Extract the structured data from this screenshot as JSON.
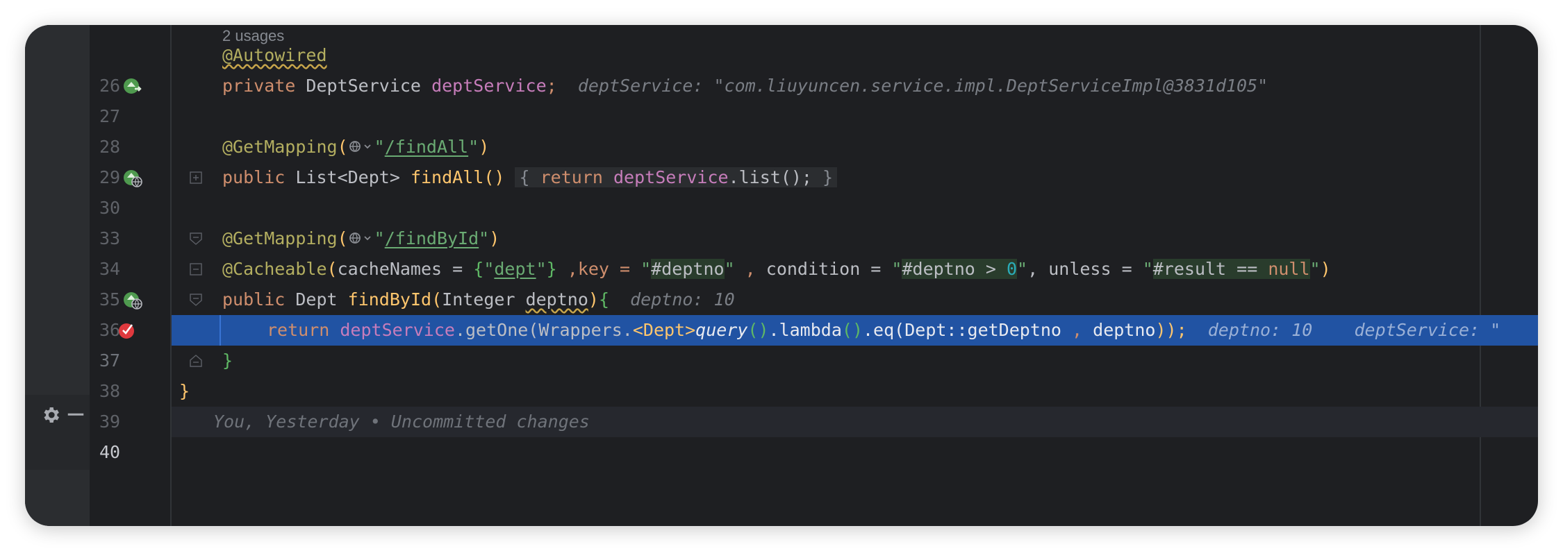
{
  "editor": {
    "usages_label": "2 usages",
    "lines": [
      {
        "n": "26"
      },
      {
        "n": "27",
        "hint": "deptService: \"com.liuyuncen.service.impl.DeptServiceImpl@3831d105\""
      },
      {
        "n": "28"
      },
      {
        "n": "29"
      },
      {
        "n": "30"
      },
      {
        "n": "33"
      },
      {
        "n": "34"
      },
      {
        "n": "35"
      },
      {
        "n": "36",
        "hint": "deptno: 10"
      },
      {
        "n": "37",
        "hint1": "deptno: 10",
        "hint2": "deptService: \""
      },
      {
        "n": "38"
      },
      {
        "n": "39"
      },
      {
        "n": "40",
        "blame": "You, Yesterday • Uncommitted changes"
      }
    ],
    "tokens": {
      "autowired": "@Autowired",
      "private": "private",
      "DeptService": "DeptService",
      "deptService": "deptService",
      "semi": ";",
      "getMapping": "@GetMapping",
      "paren_open": "(",
      "quote": "\"",
      "findAll_path": "/findAll",
      "paren_close": ")",
      "public": "public",
      "listDept": "List<Dept>",
      "findAll": "findAll",
      "emptyparens": "()",
      "lbrace": "{",
      "return": "return",
      "dotList": ".list();",
      "rbrace": "}",
      "findById_path": "/findById",
      "cacheable": "@Cacheable",
      "cacheNames": "cacheNames = ",
      "dept": "dept",
      "key": " ,key = ",
      "hashDeptno": "#deptno",
      "comma": " , ",
      "condition": "condition = ",
      "deptnoGt": "#deptno > ",
      "zero": "0",
      "unless": ", unless = ",
      "result": "#result == ",
      "null": "null",
      "Dept": "Dept",
      "findById": "findById",
      "Integer": "Integer",
      "deptno": "deptno",
      "getOne": ".getOne(",
      "wrappers": "Wrappers.",
      "genericDept": "<Dept>",
      "query": "query",
      "lambda": ".lambda",
      "eq": ".eq(",
      "methodRef": "Dept::getDeptno",
      "closeAll": "));"
    }
  }
}
